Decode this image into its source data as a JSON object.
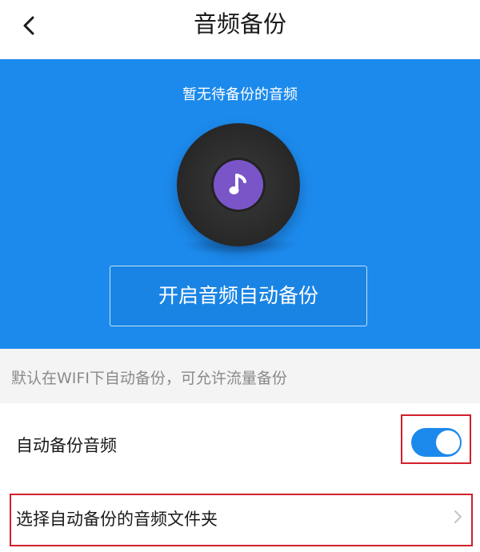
{
  "header": {
    "title": "音频备份",
    "back_icon": "chevron-left-icon"
  },
  "hero": {
    "status_text": "暂无待备份的音频",
    "disc_icon": "music-note-icon",
    "cta_label": "开启音频自动备份",
    "background_color": "#1c8aec"
  },
  "hint": {
    "text": "默认在WIFI下自动备份，可允许流量备份"
  },
  "settings": {
    "auto_backup": {
      "label": "自动备份音频",
      "enabled": true
    },
    "folder": {
      "label": "选择自动备份的音频文件夹",
      "icon": "chevron-right-icon"
    }
  },
  "colors": {
    "accent": "#1c8aec",
    "highlight_border": "#d2202c"
  }
}
